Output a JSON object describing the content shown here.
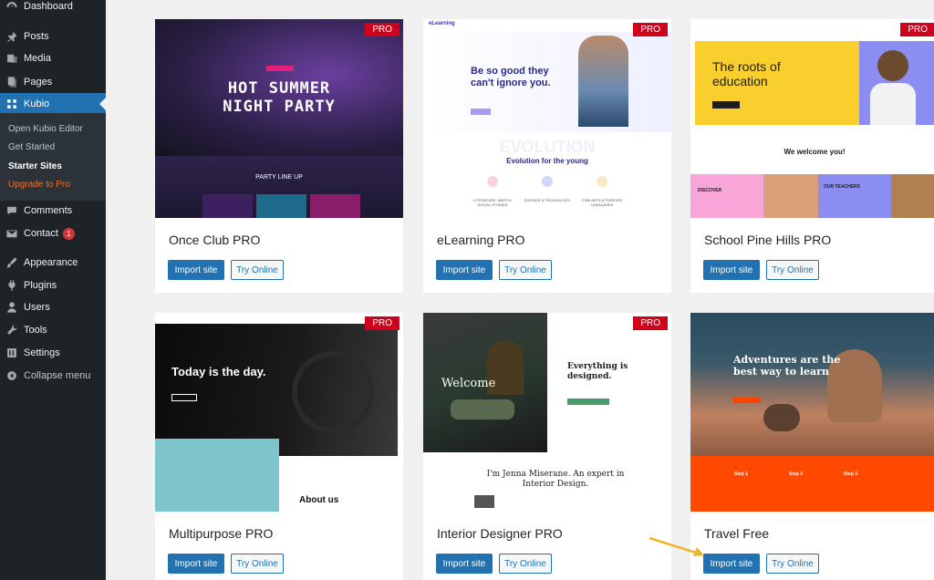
{
  "sidebar": {
    "items": [
      {
        "label": "Dashboard",
        "icon": "dashboard-icon"
      },
      {
        "label": "Posts",
        "icon": "pin-icon"
      },
      {
        "label": "Media",
        "icon": "media-icon"
      },
      {
        "label": "Pages",
        "icon": "pages-icon"
      },
      {
        "label": "Kubio",
        "icon": "kubio-icon"
      },
      {
        "label": "Comments",
        "icon": "comment-icon"
      },
      {
        "label": "Contact",
        "icon": "mail-icon",
        "badge": "1"
      },
      {
        "label": "Appearance",
        "icon": "brush-icon"
      },
      {
        "label": "Plugins",
        "icon": "plugin-icon"
      },
      {
        "label": "Users",
        "icon": "user-icon"
      },
      {
        "label": "Tools",
        "icon": "wrench-icon"
      },
      {
        "label": "Settings",
        "icon": "settings-icon"
      },
      {
        "label": "Collapse menu",
        "icon": "collapse-icon"
      }
    ],
    "submenu": [
      "Open Kubio Editor",
      "Get Started",
      "Starter Sites",
      "Upgrade to Pro"
    ]
  },
  "cards": [
    {
      "title": "Once Club PRO",
      "pro": "PRO",
      "import": "Import site",
      "try": "Try Online",
      "thumb": {
        "headline1": "HOT SUMMER",
        "headline2": "NIGHT PARTY",
        "section": "PARTY LINE UP"
      }
    },
    {
      "title": "eLearning PRO",
      "pro": "PRO",
      "import": "Import site",
      "try": "Try Online",
      "thumb": {
        "logo": "eLearning",
        "headline": "Be so good they can't ignore you.",
        "band": "EVOLUTION",
        "section": "Evolution for the young",
        "features": [
          "LITERATURE, MATH & SOCIAL STUDIES",
          "SCIENCE & TECHNOLOGY",
          "FINE ARTS & FOREIGN LANGUAGES"
        ]
      }
    },
    {
      "title": "School Pine Hills PRO",
      "pro": "PRO",
      "import": "Import site",
      "try": "Try Online",
      "thumb": {
        "headline": "The roots of education",
        "welcome": "We welcome you!",
        "panels": [
          "DISCOVER",
          "OUR TEACHERS"
        ]
      }
    },
    {
      "title": "Multipurpose PRO",
      "pro": "PRO",
      "import": "Import site",
      "try": "Try Online",
      "thumb": {
        "headline": "Today is the day.",
        "section": "About us"
      }
    },
    {
      "title": "Interior Designer PRO",
      "pro": "PRO",
      "import": "Import site",
      "try": "Try Online",
      "thumb": {
        "welcome": "Welcome",
        "headline": "Everything is designed.",
        "intro": "I'm Jenna Miserane. An expert in Interior Design."
      }
    },
    {
      "title": "Travel Free",
      "pro": "",
      "import": "Import site",
      "try": "Try Online",
      "thumb": {
        "headline": "Adventures are the best way to learn",
        "steps": [
          "Step 1",
          "Step 2",
          "Step 3"
        ]
      }
    }
  ],
  "colors": {
    "accent": "#2271b1",
    "sidebar": "#1d2327",
    "pro": "#d0021b",
    "upgrade": "#f56e28"
  }
}
